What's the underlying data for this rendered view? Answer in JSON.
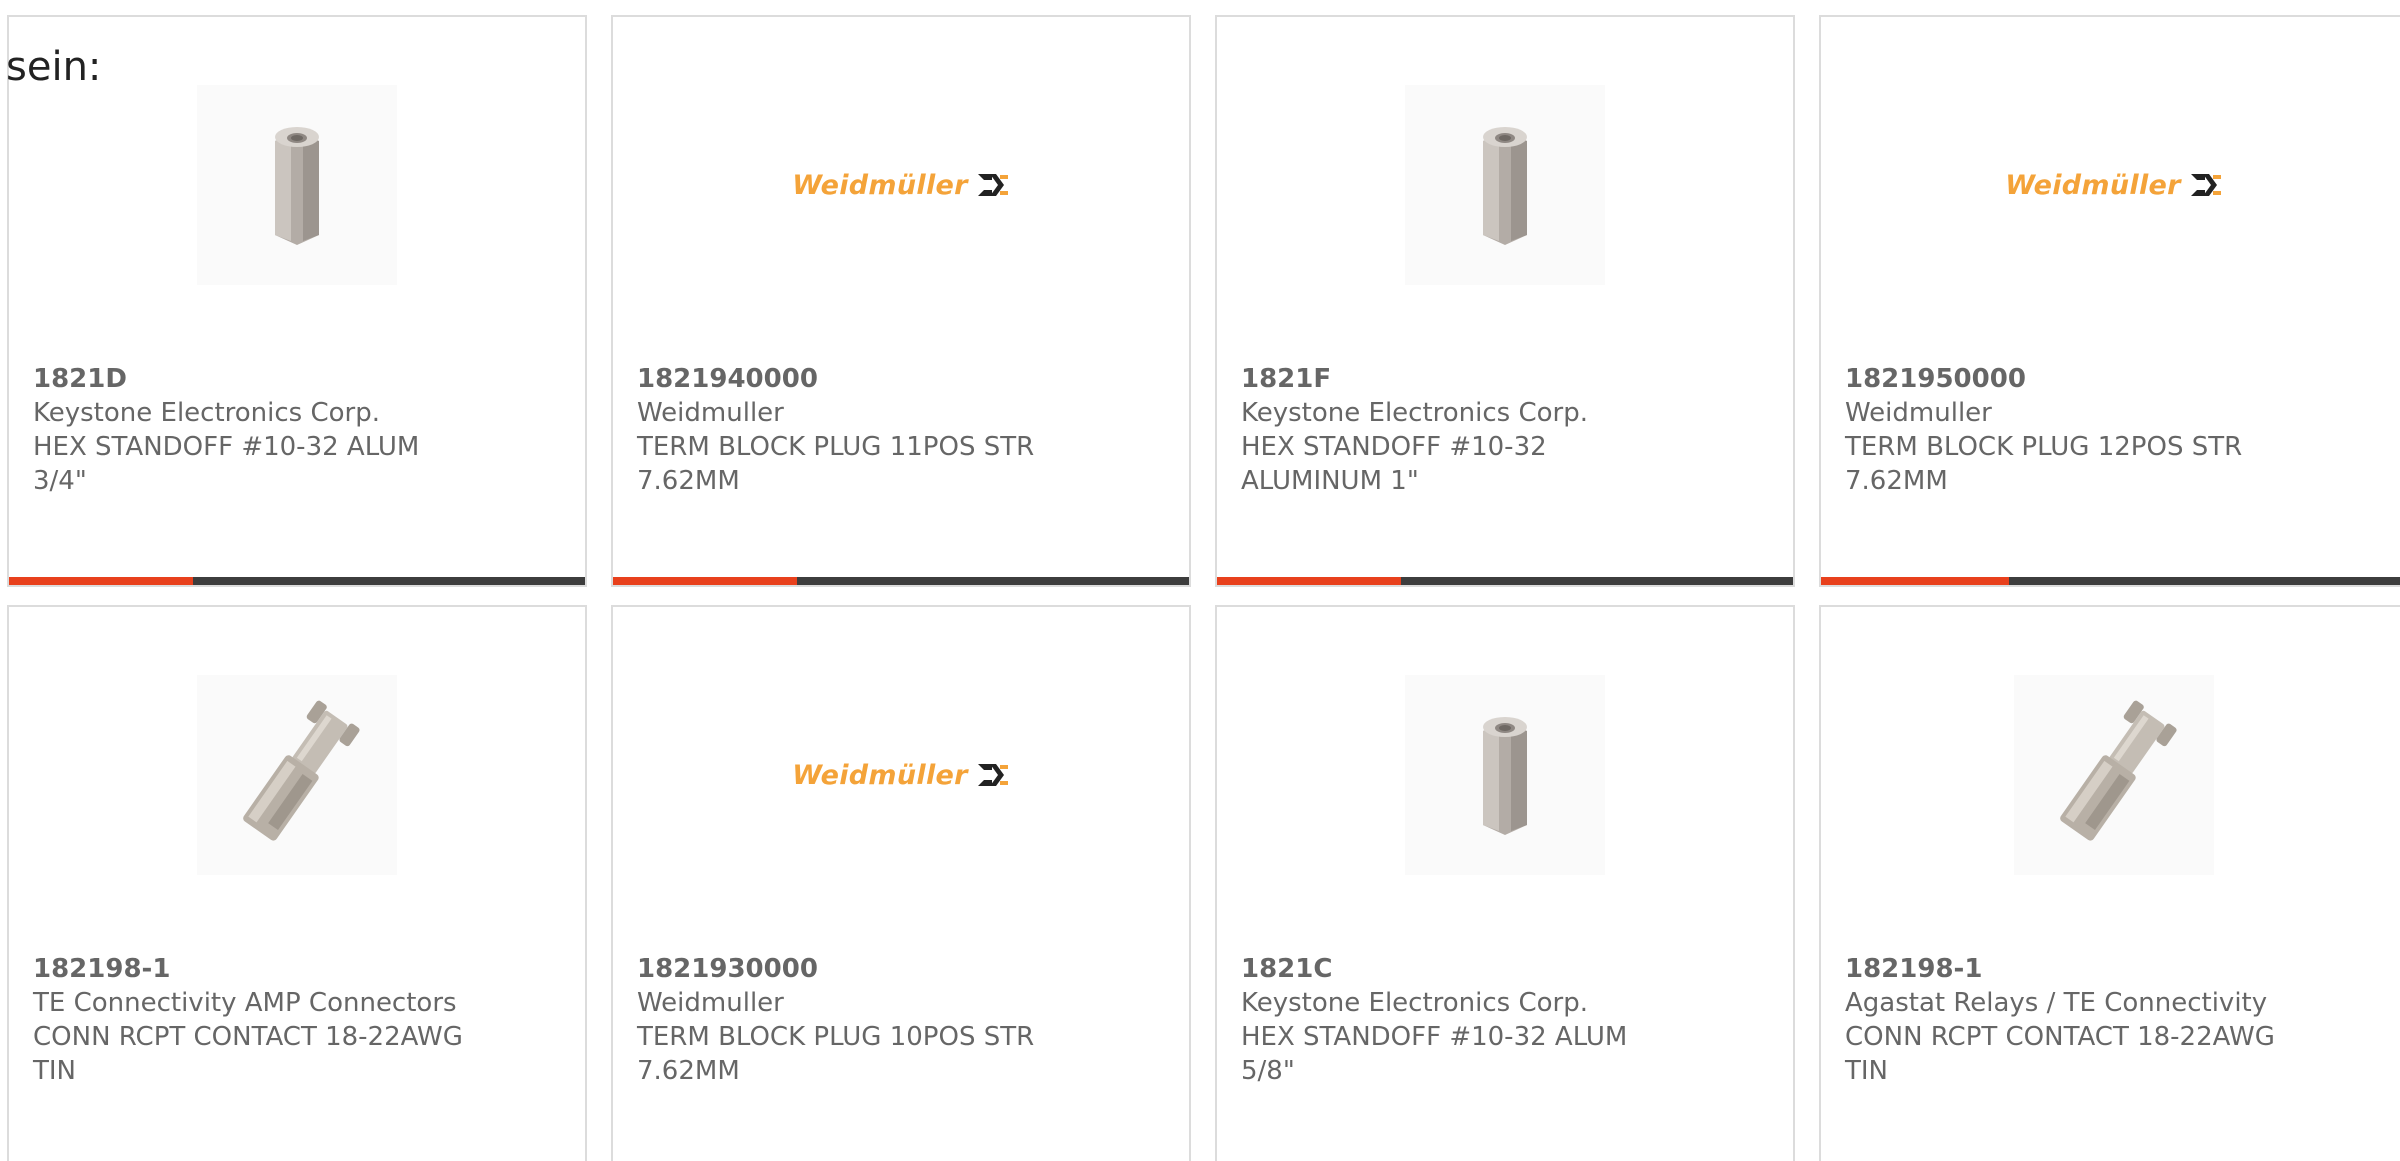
{
  "heading_fragment": "sein:",
  "accent_color": "#e8401c",
  "track_color": "#3d3d3d",
  "cards": [
    {
      "part_no": "1821D",
      "maker": "Keystone Electronics Corp.",
      "desc": "HEX STANDOFF #10-32 ALUM 3/4\"",
      "image": "hex-standoff",
      "progress": 0.32
    },
    {
      "part_no": "1821940000",
      "maker": "Weidmuller",
      "desc": "TERM BLOCK PLUG 11POS STR 7.62MM",
      "image": "weidmuller-logo",
      "logo_text": "Weidmüller",
      "progress": 0.32
    },
    {
      "part_no": "1821F",
      "maker": "Keystone Electronics Corp.",
      "desc": "HEX STANDOFF #10-32 ALUMINUM 1\"",
      "image": "hex-standoff",
      "progress": 0.32
    },
    {
      "part_no": "1821950000",
      "maker": "Weidmuller",
      "desc": "TERM BLOCK PLUG 12POS STR 7.62MM",
      "image": "weidmuller-logo",
      "logo_text": "Weidmüller",
      "progress": 0.32
    },
    {
      "part_no": "182198-1",
      "maker": "TE Connectivity AMP Connectors",
      "desc": "CONN RCPT CONTACT 18-22AWG TIN",
      "image": "crimp-contact"
    },
    {
      "part_no": "1821930000",
      "maker": "Weidmuller",
      "desc": "TERM BLOCK PLUG 10POS STR 7.62MM",
      "image": "weidmuller-logo",
      "logo_text": "Weidmüller"
    },
    {
      "part_no": "1821C",
      "maker": "Keystone Electronics Corp.",
      "desc": "HEX STANDOFF #10-32 ALUM 5/8\"",
      "image": "hex-standoff"
    },
    {
      "part_no": "182198-1",
      "maker": "Agastat Relays / TE Connectivity",
      "desc": "CONN RCPT CONTACT 18-22AWG TIN",
      "image": "crimp-contact"
    }
  ]
}
